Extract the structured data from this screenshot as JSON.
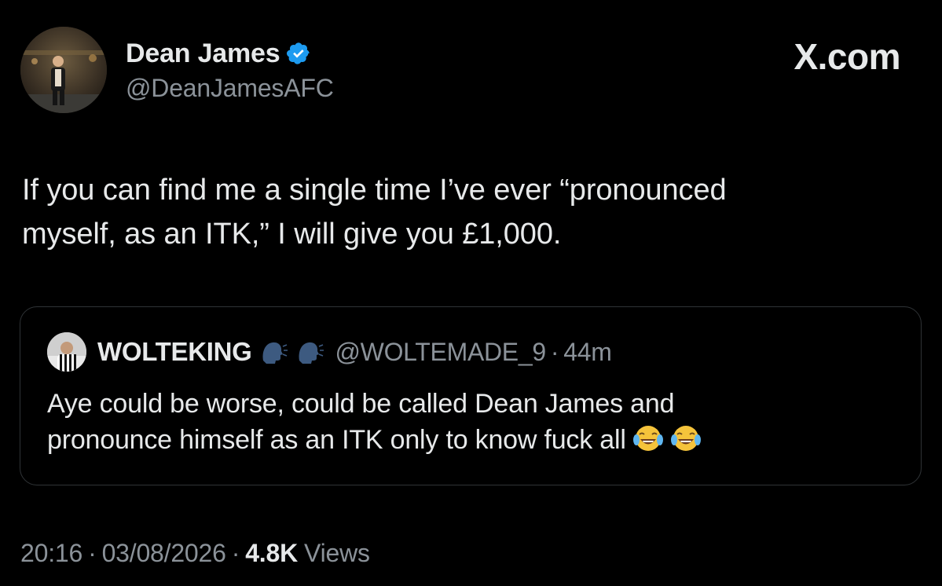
{
  "author": {
    "name": "Dean James",
    "handle": "@DeanJamesAFC",
    "verified": true,
    "verified_color": "#1d9bf0"
  },
  "brand": {
    "label": "X.com"
  },
  "tweet": {
    "text_line1": "If you can find me a single time I’ve ever “pronounced",
    "text_line2": "myself, as an ITK,” I will give you £1,000."
  },
  "quote": {
    "name": "WOLTEKING",
    "name_emojis": [
      "speaking-head-emoji",
      "speaking-head-emoji"
    ],
    "handle": "@WOLTEMADE_9",
    "separator": "·",
    "time": "44m",
    "text_line1": "Aye could be worse, could be called Dean James and",
    "text_line2": "pronounce himself as an ITK only to know fuck all",
    "trailing_emojis": [
      "face-with-tears-of-joy-emoji",
      "face-with-tears-of-joy-emoji"
    ]
  },
  "footer": {
    "time": "20:16",
    "sep": "·",
    "date": "03/08/2026",
    "views_count": "4.8K",
    "views_label": "Views"
  },
  "colors": {
    "background": "#000000",
    "primary_text": "#e7e9ea",
    "secondary_text": "#8b9299",
    "border": "#2f3336"
  }
}
